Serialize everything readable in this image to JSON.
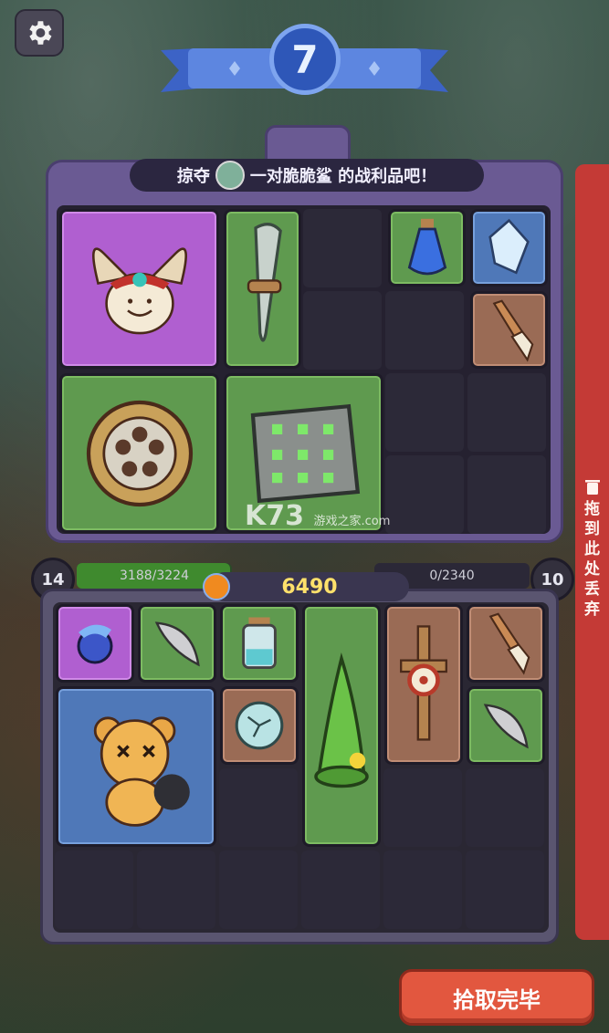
{
  "level": "7",
  "loot_panel": {
    "title_prefix": "掠夺",
    "title_suffix": "一对脆脆鲨 的战利品吧！"
  },
  "player_bar": {
    "level": "14",
    "progress_text": "3188/3224",
    "progress": 0.989
  },
  "enemy_bar": {
    "level": "10",
    "progress_text": "0/2340",
    "progress": 0
  },
  "coins": "6490",
  "discard_label": [
    "拖",
    "到",
    "此",
    "处",
    "丢",
    "弃"
  ],
  "done_button": "拾取完毕",
  "watermark": {
    "main": "K73",
    "sub": "游戏之家",
    "domain": ".com"
  },
  "loot_items": [
    {
      "name": "moth-creature",
      "rarity": "purple"
    },
    {
      "name": "bone-dagger",
      "rarity": "green"
    },
    {
      "name": "blue-potion",
      "rarity": "green"
    },
    {
      "name": "blue-crystal",
      "rarity": "blue"
    },
    {
      "name": "wooden-brush",
      "rarity": "brown"
    },
    {
      "name": "bronze-shield",
      "rarity": "green"
    },
    {
      "name": "rune-stone",
      "rarity": "green"
    }
  ],
  "inventory_items": [
    {
      "name": "blue-phoenix-gem",
      "rarity": "purple"
    },
    {
      "name": "feather-quill",
      "rarity": "green"
    },
    {
      "name": "water-jar",
      "rarity": "green"
    },
    {
      "name": "green-hat",
      "rarity": "green"
    },
    {
      "name": "training-dummy",
      "rarity": "brown"
    },
    {
      "name": "wooden-brush",
      "rarity": "brown"
    },
    {
      "name": "teddy-bear",
      "rarity": "blue"
    },
    {
      "name": "cracked-orb",
      "rarity": "brown"
    },
    {
      "name": "feather-quill-2",
      "rarity": "green"
    }
  ]
}
